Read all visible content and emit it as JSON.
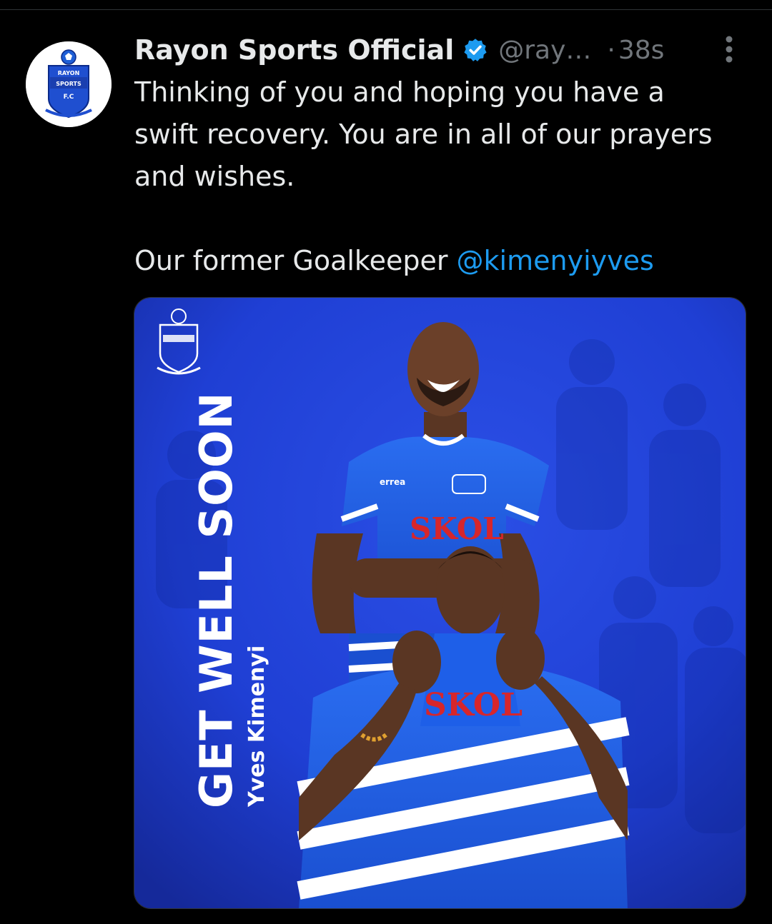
{
  "tweet": {
    "author": {
      "display_name": "Rayon Sports Official",
      "handle": "@ray…",
      "verified": true,
      "avatar_icon": "rayon-sports-crest",
      "avatar_text_lines": [
        "RAYON",
        "SPORTS",
        "F.C"
      ]
    },
    "separator": "·",
    "timestamp": "38s",
    "more_icon": "vertical-ellipsis-icon",
    "text_paragraph_1": "Thinking of you and hoping you have a swift recovery. You are in all of our prayers and wishes.",
    "text_paragraph_2_prefix": "Our former Goalkeeper ",
    "mention": "@kimenyiyves"
  },
  "media": {
    "headline": "GET WELL SOON",
    "subheadline": "Yves Kimenyi",
    "jersey_sponsor": "SKOL",
    "kit_brand": "errea",
    "colors": {
      "background": "#1f3fd4",
      "jersey": "#1e5fe8",
      "stripe": "#ffffff",
      "sponsor_red": "#d7262b"
    }
  },
  "colors": {
    "background": "#000000",
    "text": "#e7e9ea",
    "muted": "#71767b",
    "link": "#1d9bf0",
    "verified": "#1d9bf0"
  }
}
